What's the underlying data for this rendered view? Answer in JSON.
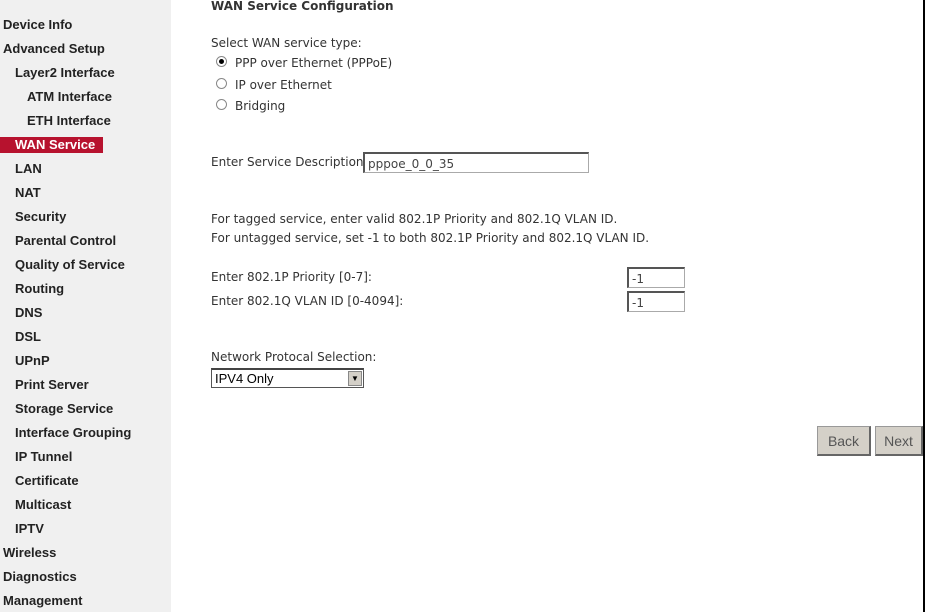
{
  "sidebar": {
    "items": [
      {
        "label": "Device Info",
        "level": 0
      },
      {
        "label": "Advanced Setup",
        "level": 0
      },
      {
        "label": "Layer2 Interface",
        "level": 1
      },
      {
        "label": "ATM Interface",
        "level": 2
      },
      {
        "label": "ETH Interface",
        "level": 2
      },
      {
        "label": "WAN Service",
        "level": 1,
        "active": true
      },
      {
        "label": "LAN",
        "level": 1
      },
      {
        "label": "NAT",
        "level": 1
      },
      {
        "label": "Security",
        "level": 1
      },
      {
        "label": "Parental Control",
        "level": 1
      },
      {
        "label": "Quality of Service",
        "level": 1
      },
      {
        "label": "Routing",
        "level": 1
      },
      {
        "label": "DNS",
        "level": 1
      },
      {
        "label": "DSL",
        "level": 1
      },
      {
        "label": "UPnP",
        "level": 1
      },
      {
        "label": "Print Server",
        "level": 1
      },
      {
        "label": "Storage Service",
        "level": 1
      },
      {
        "label": "Interface Grouping",
        "level": 1
      },
      {
        "label": "IP Tunnel",
        "level": 1
      },
      {
        "label": "Certificate",
        "level": 1
      },
      {
        "label": "Multicast",
        "level": 1
      },
      {
        "label": "IPTV",
        "level": 1
      },
      {
        "label": "Wireless",
        "level": 0
      },
      {
        "label": "Diagnostics",
        "level": 0
      },
      {
        "label": "Management",
        "level": 0
      }
    ],
    "active_color": "#b7122e"
  },
  "main": {
    "title": "WAN Service Configuration",
    "service_type_label": "Select WAN service type:",
    "service_types": [
      {
        "label": "PPP over Ethernet (PPPoE)",
        "selected": true
      },
      {
        "label": "IP over Ethernet",
        "selected": false
      },
      {
        "label": "Bridging",
        "selected": false
      }
    ],
    "service_desc_label": "Enter Service Description:",
    "service_desc_value": "pppoe_0_0_35",
    "tagged_note": "For tagged service, enter valid 802.1P Priority and 802.1Q VLAN ID.",
    "untagged_note": "For untagged service, set -1 to both 802.1P Priority and 802.1Q VLAN ID.",
    "priority_label": "Enter 802.1P Priority [0-7]:",
    "priority_value": "-1",
    "vlan_label": "Enter 802.1Q VLAN ID [0-4094]:",
    "vlan_value": "-1",
    "protocol_label": "Network Protocal Selection:",
    "protocol_value": "IPV4 Only",
    "back_label": "Back",
    "next_label": "Next"
  }
}
